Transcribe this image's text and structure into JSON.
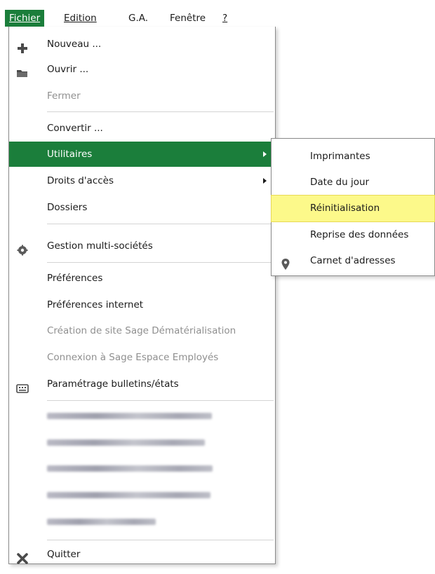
{
  "menubar": {
    "items": [
      {
        "label": "Fichier",
        "active": true
      },
      {
        "label": "Edition"
      },
      {
        "label": "G.A."
      },
      {
        "label": "Fenêtre"
      },
      {
        "label": "?"
      }
    ]
  },
  "fichier_menu": {
    "items": {
      "nouveau": {
        "label": "Nouveau ...",
        "icon": "plus-icon"
      },
      "ouvrir": {
        "label": "Ouvrir ...",
        "icon": "folder-icon"
      },
      "fermer": {
        "label": "Fermer",
        "disabled": true
      },
      "convertir": {
        "label": "Convertir ..."
      },
      "utilitaires": {
        "label": "Utilitaires",
        "selected": true,
        "submenu": true
      },
      "droits": {
        "label": "Droits d'accès",
        "submenu": true
      },
      "dossiers": {
        "label": "Dossiers"
      },
      "gestion": {
        "label": "Gestion multi-sociétés",
        "icon": "gear-icon"
      },
      "preferences": {
        "label": "Préférences"
      },
      "preferences_internet": {
        "label": "Préférences internet"
      },
      "creation_site": {
        "label": "Création de site Sage Dématérialisation",
        "disabled": true
      },
      "connexion": {
        "label": "Connexion à Sage Espace Employés",
        "disabled": true
      },
      "parametrage": {
        "label": "Paramétrage bulletins/états",
        "icon": "keyboard-icon"
      },
      "quitter": {
        "label": "Quitter",
        "icon": "close-x-icon"
      }
    },
    "recent_files_blurred": 5
  },
  "utilitaires_submenu": {
    "items": {
      "imprimantes": {
        "label": "Imprimantes"
      },
      "date_jour": {
        "label": "Date du jour"
      },
      "reinit": {
        "label": "Réinitialisation",
        "highlighted": true
      },
      "reprise": {
        "label": "Reprise des données"
      },
      "carnet": {
        "label": "Carnet d'adresses",
        "icon": "map-pin-icon"
      }
    }
  },
  "colors": {
    "accent_green": "#1b7e3b",
    "highlight_yellow": "#fcf98a",
    "disabled_gray": "#8f8f8f"
  }
}
